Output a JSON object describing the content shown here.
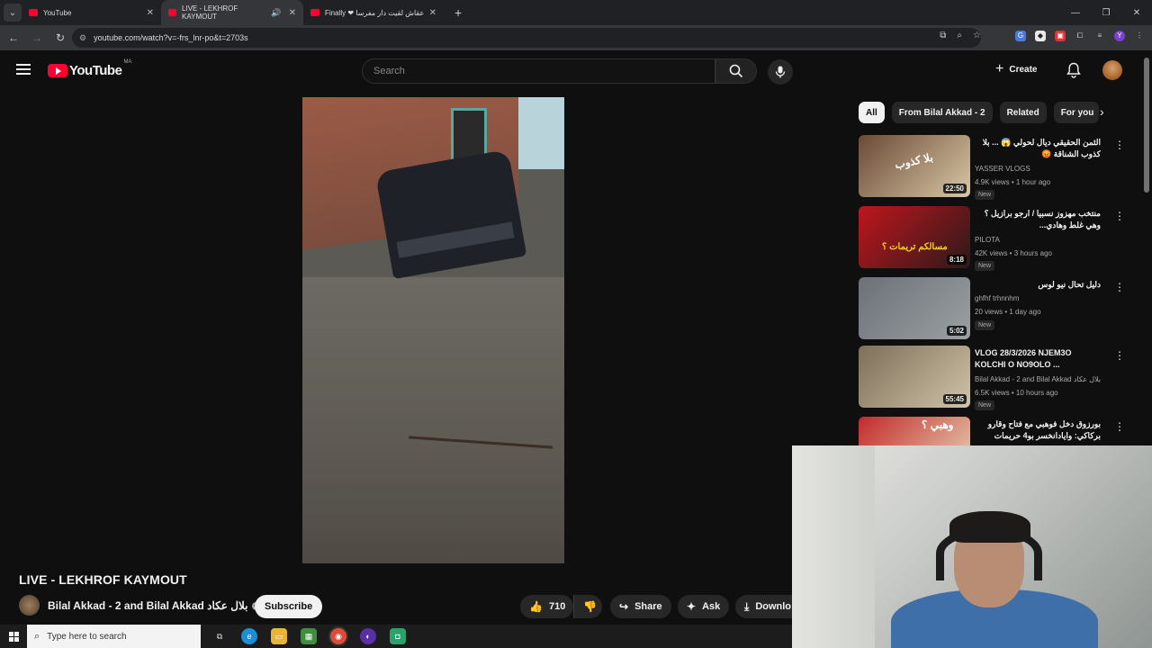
{
  "browser": {
    "tabs": [
      {
        "label": "YouTube",
        "active": false
      },
      {
        "label": "LIVE - LEKHROF KAYMOUT",
        "active": true
      },
      {
        "label": "Finally ❤ عقاش لقيت دار مفرسا",
        "active": false
      }
    ],
    "url": "youtube.com/watch?v=-frs_lnr-po&t=2703s"
  },
  "header": {
    "logo_text": "YouTube",
    "country": "MA",
    "search_placeholder": "Search",
    "create_label": "Create"
  },
  "video": {
    "title": "LIVE - LEKHROF KAYMOUT",
    "channel": "Bilal Akkad - 2 and Bilal Akkad بلال عكاد",
    "subscribe_label": "Subscribe",
    "likes": "710",
    "share_label": "Share",
    "ask_label": "Ask",
    "download_label": "Downlo"
  },
  "chips": [
    "All",
    "From Bilal Akkad - 2",
    "Related",
    "For you"
  ],
  "recommendations": [
    {
      "title": "الثمن الحقيقي ديال لحولي 😱 ... بلا كذوب الشناقة 😡",
      "channel": "YASSER VLOGS",
      "meta": "4.9K views • 1 hour ago",
      "badge": "New",
      "duration": "22:50",
      "thumb_colors": [
        "#6b4a36",
        "#d8c8a6"
      ],
      "thumb_text": "بلا كذوب"
    },
    {
      "title": "منتخب مهزوز نسبيا / ارجو برازيل ؟ وهي غلط وهادي...",
      "channel": "PILOTA",
      "meta": "42K views • 3 hours ago",
      "badge": "New",
      "duration": "8:18",
      "thumb_colors": [
        "#c0161d",
        "#2a1a1a"
      ],
      "thumb_text": "مسالكم تريمات ؟"
    },
    {
      "title": "دليل تحال نيو لوس",
      "channel": "ghfhf trhnnhm",
      "meta": "20 views • 1 day ago",
      "badge": "New",
      "duration": "5:02",
      "thumb_colors": [
        "#6c7178",
        "#9aa0a3"
      ],
      "thumb_text": ""
    },
    {
      "title": "VLOG 28/3/2026 NJEM3O KOLCHI O NO9OLO ...",
      "channel": "Bilal Akkad - 2 and Bilal Akkad بلال عكاد",
      "meta": "6.5K views • 10 hours ago",
      "badge": "New",
      "duration": "55:45",
      "thumb_colors": [
        "#7e6f58",
        "#cfc3a8"
      ],
      "thumb_text": ""
    },
    {
      "title": "بورزوق دخل فوهبي مع فتاح وقارو بركاكي: وايادانخسر بو4 حريمات القسمكم؟",
      "channel": "",
      "meta": "",
      "badge": "",
      "duration": "",
      "thumb_colors": [
        "#c22a2a",
        "#e8d7b8"
      ],
      "thumb_text": "وهبي ؟"
    }
  ],
  "taskbar": {
    "search_placeholder": "Type here to search"
  },
  "colors": {
    "brand_red": "#ff0033",
    "background": "#0f0f0f",
    "chip_bg": "#272727"
  }
}
